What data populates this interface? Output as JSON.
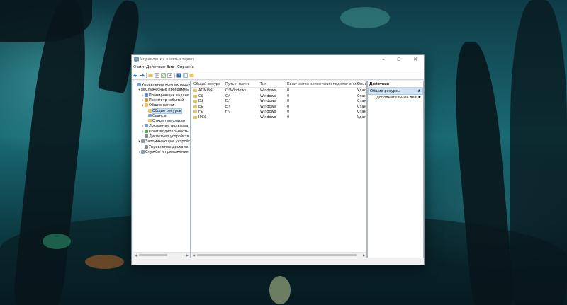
{
  "window": {
    "title": "Управление компьютером",
    "menu": [
      "Файл",
      "Действие",
      "Вид",
      "Справка"
    ],
    "controls": {
      "minimize": "–",
      "maximize": "☐",
      "close": "✕"
    }
  },
  "toolbar": {
    "icons": [
      "back-arrow-icon",
      "forward-arrow-icon",
      "up-folder-icon",
      "properties-icon",
      "refresh-icon",
      "export-list-icon",
      "help-icon",
      "show-hide-tree-icon",
      "new-share-icon"
    ]
  },
  "tree": {
    "items": [
      {
        "label": "Управление компьютером (л",
        "level": 0,
        "expander": "",
        "icon": "computer-icon"
      },
      {
        "label": "Служебные программы",
        "level": 1,
        "expander": "v",
        "icon": "tools-icon"
      },
      {
        "label": "Планировщик задани",
        "level": 2,
        "expander": ">",
        "icon": "clock-icon"
      },
      {
        "label": "Просмотр событий",
        "level": 2,
        "expander": ">",
        "icon": "event-viewer-icon"
      },
      {
        "label": "Общие папки",
        "level": 2,
        "expander": "v",
        "icon": "shared-folder-icon"
      },
      {
        "label": "Общие ресурсы",
        "level": 3,
        "expander": "",
        "icon": "shared-folder-icon",
        "selected": true
      },
      {
        "label": "Сеансы",
        "level": 3,
        "expander": "",
        "icon": "sessions-icon"
      },
      {
        "label": "Открытые файлы",
        "level": 3,
        "expander": "",
        "icon": "open-files-icon"
      },
      {
        "label": "Локальные пользоват",
        "level": 2,
        "expander": ">",
        "icon": "users-icon"
      },
      {
        "label": "Производительность",
        "level": 2,
        "expander": ">",
        "icon": "performance-icon"
      },
      {
        "label": "Диспетчер устройств",
        "level": 2,
        "expander": "",
        "icon": "device-manager-icon"
      },
      {
        "label": "Запоминающие устройст",
        "level": 1,
        "expander": "v",
        "icon": "storage-icon"
      },
      {
        "label": "Управление дисками",
        "level": 2,
        "expander": "",
        "icon": "disk-icon"
      },
      {
        "label": "Службы и приложения",
        "level": 1,
        "expander": ">",
        "icon": "services-icon"
      }
    ]
  },
  "list": {
    "columns": [
      "Общий ресурс",
      "Путь к папке",
      "Тип",
      "Количество клиентских подключений",
      "Опис"
    ],
    "rows": [
      [
        "ADMIN$",
        "C:\\Windows",
        "Windows",
        "0",
        "Удал"
      ],
      [
        "C$",
        "C:\\",
        "Windows",
        "0",
        "Стан"
      ],
      [
        "D$",
        "D:\\",
        "Windows",
        "0",
        "Стан"
      ],
      [
        "E$",
        "E:\\",
        "Windows",
        "0",
        "Стан"
      ],
      [
        "F$",
        "F:\\",
        "Windows",
        "0",
        "Стан"
      ],
      [
        "IPC$",
        "",
        "Windows",
        "0",
        "Удал"
      ]
    ]
  },
  "actions": {
    "title": "Действия",
    "group": "Общие ресурсы",
    "items": [
      "Дополнительные дей..."
    ]
  },
  "colors": {
    "selection": "#cce4f7",
    "action_group": "#cfe3f5",
    "window_bg": "#f0f0f0"
  }
}
